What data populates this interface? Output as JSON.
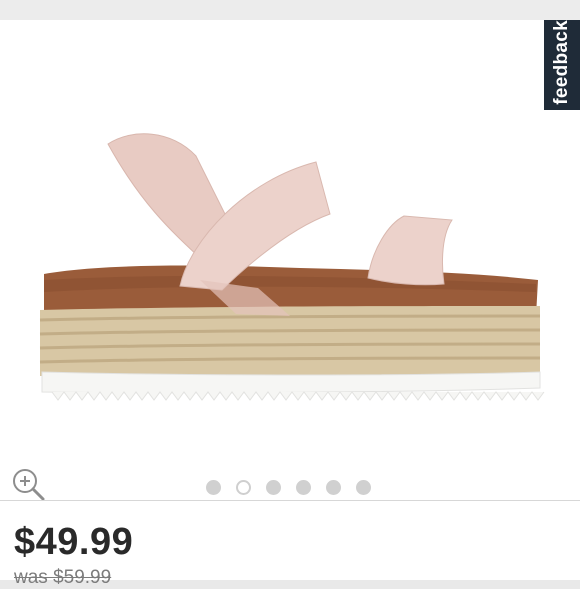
{
  "feedback": {
    "label": "feedback"
  },
  "product": {
    "image_alt": "Blush elastic-strap espadrille flatform sandal",
    "price": "$49.99",
    "was_price": "was $59.99"
  },
  "gallery": {
    "dots": [
      "image 1",
      "image 2",
      "image 3",
      "image 4",
      "image 5",
      "image 6"
    ],
    "active_index": 1
  },
  "icons": {
    "zoom": "zoom-in-icon"
  },
  "colors": {
    "feedback_bg": "#1f2b38",
    "price_text": "#2a2a2a",
    "strap": "#ecd2cb",
    "cork": "#9a5c3a",
    "jute": "#d8c7a4",
    "sole": "#f6f6f4"
  }
}
